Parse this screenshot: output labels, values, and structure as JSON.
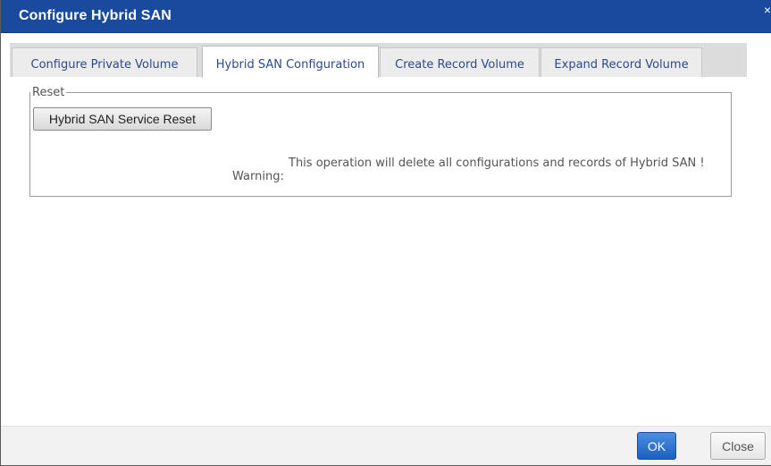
{
  "dialog": {
    "title": "Configure Hybrid SAN",
    "close_glyph": "×"
  },
  "tabs": [
    {
      "label": "Configure Private Volume",
      "active": false
    },
    {
      "label": "Hybrid SAN Configuration",
      "active": true
    },
    {
      "label": "Create Record Volume",
      "active": false
    },
    {
      "label": "Expand Record Volume",
      "active": false
    }
  ],
  "reset_section": {
    "legend": "Reset",
    "button_label": "Hybrid SAN Service Reset",
    "warning_label": "Warning:",
    "warning_text": "This operation will delete all configurations and records of Hybrid SAN !"
  },
  "footer": {
    "ok_label": "OK",
    "close_label": "Close"
  },
  "colors": {
    "titlebar": "#1a4a9c",
    "ok_button": "#2a6fd0",
    "tab_text": "#2b4a8a"
  }
}
